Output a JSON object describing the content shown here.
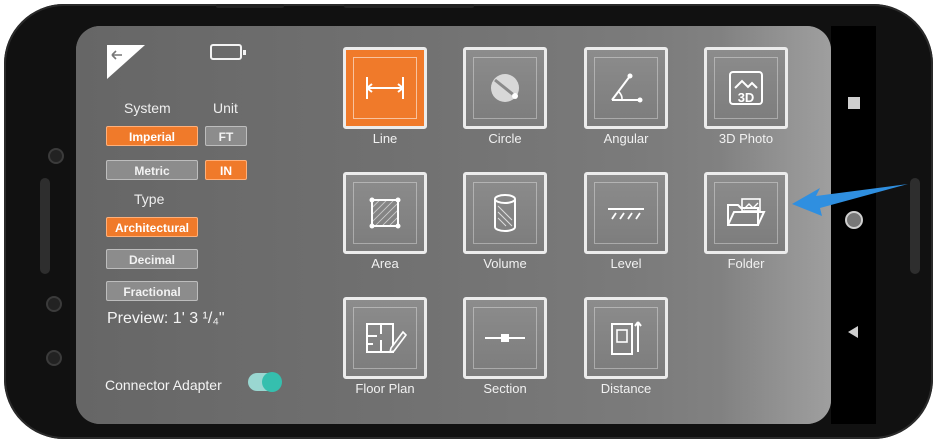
{
  "settings": {
    "system_label": "System",
    "unit_label": "Unit",
    "systems": [
      "Imperial",
      "Metric"
    ],
    "selected_system": "Imperial",
    "units": [
      "FT",
      "IN"
    ],
    "selected_unit": "IN",
    "type_label": "Type",
    "types": [
      "Architectural",
      "Decimal",
      "Fractional"
    ],
    "selected_type": "Architectural",
    "preview": "Preview: 1' 3 ¹/₄\""
  },
  "connector": {
    "label": "Connector Adapter",
    "enabled": true
  },
  "tools": [
    {
      "label": "Line",
      "icon": "line-measure-icon",
      "active": true
    },
    {
      "label": "Circle",
      "icon": "circle-icon",
      "active": false
    },
    {
      "label": "Angular",
      "icon": "angle-icon",
      "active": false
    },
    {
      "label": "3D Photo",
      "icon": "3d-photo-icon",
      "active": false
    },
    {
      "label": "Area",
      "icon": "area-icon",
      "active": false
    },
    {
      "label": "Volume",
      "icon": "cylinder-icon",
      "active": false
    },
    {
      "label": "Level",
      "icon": "level-icon",
      "active": false
    },
    {
      "label": "Folder",
      "icon": "folder-icon",
      "active": false
    },
    {
      "label": "Floor Plan",
      "icon": "floor-plan-icon",
      "active": false
    },
    {
      "label": "Section",
      "icon": "section-icon",
      "active": false
    },
    {
      "label": "Distance",
      "icon": "distance-icon",
      "active": false
    }
  ],
  "colors": {
    "accent": "#f07a2a",
    "toggle_on": "#35bfae",
    "annotation_arrow": "#2f8fe0"
  }
}
